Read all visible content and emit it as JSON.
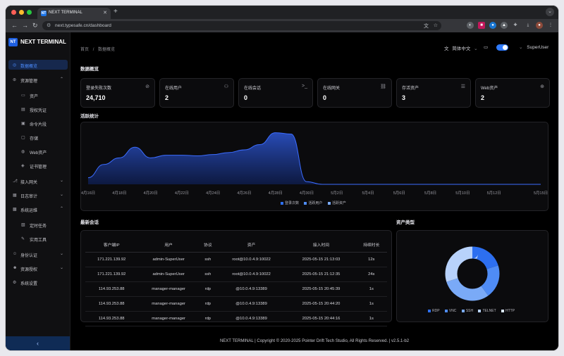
{
  "browser": {
    "tab_title": "NEXT TERMINAL",
    "tab_favicon": "NT",
    "url": "next.typesafe.cn/dashboard"
  },
  "sidebar": {
    "logo_badge": "NT",
    "logo_text": "NEXT TERMINAL",
    "items": [
      {
        "label": "数据概览",
        "icon": "dashboard-icon"
      },
      {
        "label": "资源管理",
        "icon": "resource-icon"
      },
      {
        "label": "资产",
        "icon": "monitor-icon"
      },
      {
        "label": "授权凭证",
        "icon": "credential-icon"
      },
      {
        "label": "命令片段",
        "icon": "code-icon"
      },
      {
        "label": "存储",
        "icon": "storage-icon"
      },
      {
        "label": "Web资产",
        "icon": "globe-icon"
      },
      {
        "label": "证书管理",
        "icon": "certificate-icon"
      },
      {
        "label": "接入网关",
        "icon": "gateway-icon"
      },
      {
        "label": "日志审计",
        "icon": "audit-icon"
      },
      {
        "label": "系统运维",
        "icon": "ops-icon"
      },
      {
        "label": "定时任务",
        "icon": "schedule-icon"
      },
      {
        "label": "实用工具",
        "icon": "tool-icon"
      },
      {
        "label": "身份认证",
        "icon": "user-icon"
      },
      {
        "label": "资源授权",
        "icon": "authorize-icon"
      },
      {
        "label": "系统设置",
        "icon": "settings-icon"
      }
    ],
    "collapse_label": "‹"
  },
  "header": {
    "breadcrumb_home": "首页",
    "breadcrumb_sep": "/",
    "breadcrumb_current": "数据概览",
    "language": "简体中文",
    "user": "SuperUser"
  },
  "overview": {
    "title": "数据概览",
    "cards": [
      {
        "label": "登录失败次数",
        "value": "24,710",
        "icon": "ban-icon"
      },
      {
        "label": "在线用户",
        "value": "2",
        "icon": "users-icon"
      },
      {
        "label": "在线会话",
        "value": "0",
        "icon": "terminal-icon"
      },
      {
        "label": "在线网关",
        "value": "0",
        "icon": "link-icon"
      },
      {
        "label": "存活资产",
        "value": "3",
        "icon": "server-icon"
      },
      {
        "label": "Web资产",
        "value": "2",
        "icon": "web-icon"
      }
    ]
  },
  "activity": {
    "title": "活跃统计"
  },
  "chart_data": {
    "type": "area",
    "x": [
      "4月16日",
      "4月17日",
      "4月18日",
      "4月19日",
      "4月20日",
      "4月21日",
      "4月22日",
      "4月23日",
      "4月24日",
      "4月25日",
      "4月26日",
      "4月27日",
      "4月28日",
      "4月29日",
      "4月30日",
      "5月1日",
      "5月2日",
      "5月3日",
      "5月4日",
      "5月5日",
      "5月6日",
      "5月7日",
      "5月8日",
      "5月9日",
      "5月10日",
      "5月11日",
      "5月12日",
      "5月13日",
      "5月14日",
      "5月15日"
    ],
    "xticks": [
      "4月16日",
      "4月18日",
      "4月20日",
      "4月22日",
      "4月24日",
      "4月26日",
      "4月28日",
      "4月30日",
      "5月2日",
      "5月4日",
      "5月6日",
      "5月8日",
      "5月10日",
      "5月12日",
      "5月15日"
    ],
    "series": [
      {
        "name": "登录次数",
        "values": [
          10,
          30,
          40,
          56,
          40,
          44,
          44,
          43,
          45,
          48,
          52,
          60,
          78,
          76,
          4,
          0,
          0,
          0,
          0,
          0,
          0,
          0,
          0,
          0,
          0,
          0,
          0,
          0,
          0,
          0
        ]
      },
      {
        "name": "活跃用户",
        "values": [
          1,
          1,
          1,
          1,
          1,
          1,
          1,
          1,
          1,
          1,
          1,
          1,
          1,
          1,
          1,
          0,
          0,
          0,
          0,
          0,
          0,
          0,
          0,
          0,
          0,
          0,
          0,
          0,
          0,
          0
        ]
      },
      {
        "name": "活跃资产",
        "values": [
          1,
          1,
          1,
          1,
          1,
          1,
          1,
          1,
          1,
          1,
          1,
          1,
          1,
          1,
          1,
          0,
          0,
          0,
          0,
          0,
          0,
          0,
          0,
          0,
          0,
          0,
          0,
          0,
          0,
          0
        ]
      }
    ],
    "colors": {
      "area": "#2a4fbf",
      "line": "#3b6cff"
    },
    "legend_position": "bottom",
    "ylim": [
      0,
      85
    ]
  },
  "sessions": {
    "title": "最新会话",
    "columns": [
      "客户端IP",
      "用户",
      "协议",
      "资产",
      "接入时间",
      "持续时长"
    ],
    "rows": [
      [
        "171.221.139.92",
        "admin-SuperUser",
        "ssh",
        "root@10.0.4.9:10022",
        "2025-05-15 21:13:03",
        "12s"
      ],
      [
        "171.221.139.92",
        "admin-SuperUser",
        "ssh",
        "root@10.0.4.9:10022",
        "2025-05-15 21:12:35",
        "24s"
      ],
      [
        "114.93.253.88",
        "manager-manager",
        "rdp",
        "@10.0.4.9:13389",
        "2025-05-15 20:45:39",
        "1s"
      ],
      [
        "114.93.253.88",
        "manager-manager",
        "rdp",
        "@10.0.4.9:13389",
        "2025-05-15 20:44:20",
        "1s"
      ],
      [
        "114.93.253.88",
        "manager-manager",
        "rdp",
        "@10.0.4.9:13389",
        "2025-05-15 20:44:16",
        "1s"
      ]
    ]
  },
  "asset_types": {
    "title": "资产类型",
    "legend": [
      {
        "name": "RDP",
        "color": "#2d6ff0",
        "value": 2
      },
      {
        "name": "VNC",
        "color": "#4f8cf5",
        "value": 2
      },
      {
        "name": "SSH",
        "color": "#7aaaf7",
        "value": 3
      },
      {
        "name": "TELNET",
        "color": "#b8d2fb",
        "value": 3
      },
      {
        "name": "HTTP",
        "color": "#dce9fd",
        "value": 0
      }
    ]
  },
  "footer": "NEXT TERMINAL | Copyright © 2020-2025 Pointer Drift Tech Studio, All Rights Reserved. | v2.5.1-b2"
}
